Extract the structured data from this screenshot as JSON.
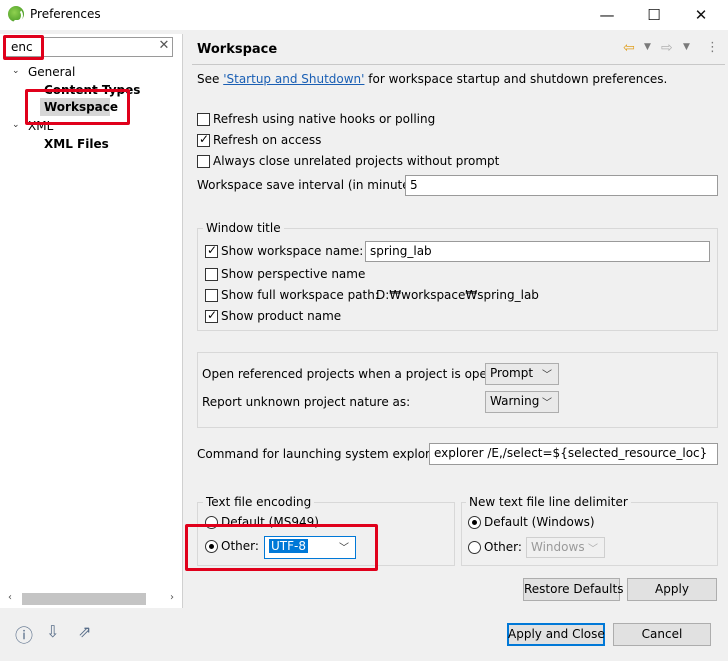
{
  "window": {
    "title": "Preferences",
    "minimize": "—",
    "maximize": "☐",
    "close": "✕"
  },
  "sidebar": {
    "filter_value": "enc",
    "filter_clear": "✕",
    "tree": {
      "general": "General",
      "content_types": "Content Types",
      "workspace": "Workspace",
      "xml": "XML",
      "xml_files": "XML Files"
    }
  },
  "page": {
    "title": "Workspace",
    "intro_prefix": "See ",
    "intro_link": "'Startup and Shutdown'",
    "intro_suffix": " for workspace startup and shutdown preferences.",
    "refresh_native_hooks": "Refresh using native hooks or polling",
    "refresh_on_access": "Refresh on access",
    "always_close": "Always close unrelated projects without prompt",
    "save_interval_label": "Workspace save interval (in minutes):",
    "save_interval_value": "5",
    "window_title_group": "Window title",
    "show_workspace_name": "Show workspace name:",
    "workspace_name_value": "spring_lab",
    "show_perspective_name": "Show perspective name",
    "show_full_path": "Show full workspace path:",
    "full_path_value": "D:₩workspace₩spring_lab",
    "show_product_name": "Show product name",
    "open_referenced_label": "Open referenced projects when a project is opened:",
    "open_referenced_value": "Prompt",
    "report_unknown_label": "Report unknown project nature as:",
    "report_unknown_value": "Warning",
    "explorer_cmd_label": "Command for launching system explorer:",
    "explorer_cmd_value": "explorer /E,/select=${selected_resource_loc}",
    "encoding_group": "Text file encoding",
    "encoding_default": "Default (MS949)",
    "encoding_other": "Other:",
    "encoding_other_value": "UTF-8",
    "delimiter_group": "New text file line delimiter",
    "delimiter_default": "Default (Windows)",
    "delimiter_other": "Other:",
    "delimiter_other_value": "Windows",
    "restore_defaults": "Restore Defaults",
    "apply": "Apply"
  },
  "footer": {
    "apply_and_close": "Apply and Close",
    "cancel": "Cancel"
  },
  "icons": {
    "help": "help-icon",
    "import": "import-icon",
    "export": "export-icon",
    "back": "back-arrow-icon",
    "forward": "forward-arrow-icon"
  },
  "colors": {
    "highlight_red": "#e0001b",
    "link_blue": "#1a5fb4",
    "selection_blue": "#0078d7"
  }
}
